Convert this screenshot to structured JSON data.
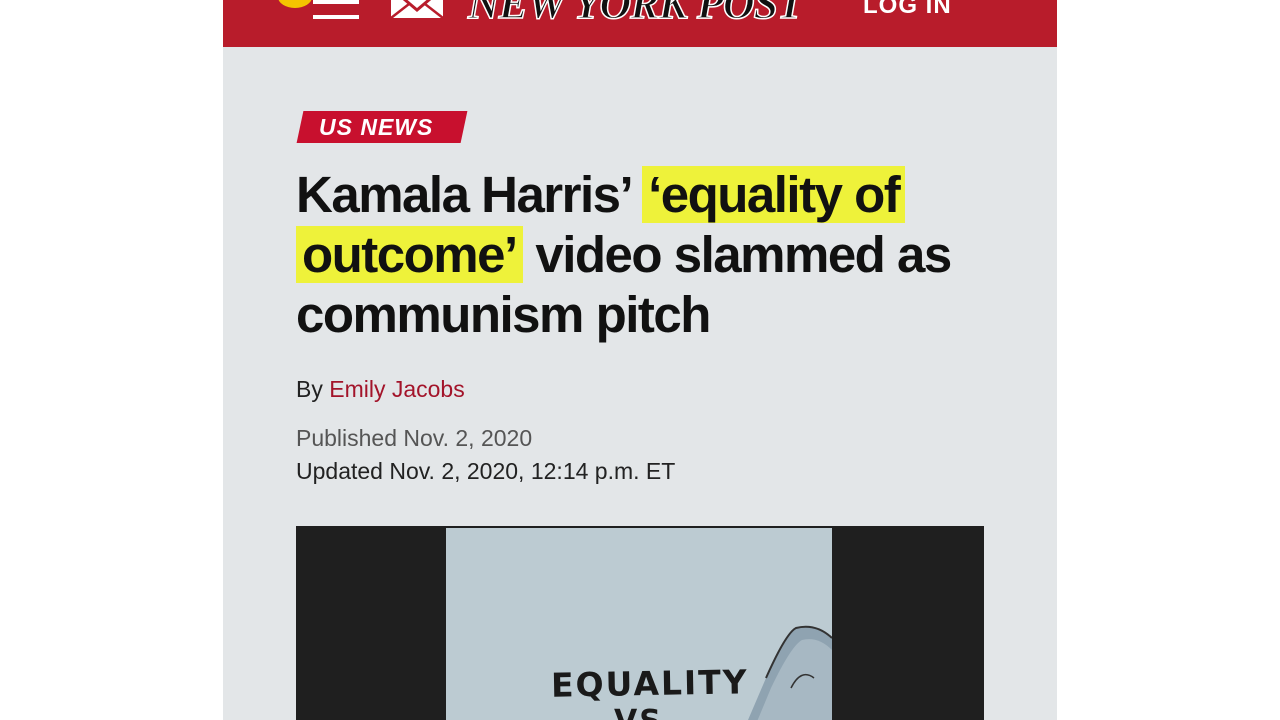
{
  "header": {
    "logo": "NEW YORK POST",
    "login_label": "LOG IN",
    "menu_icon": "hamburger-menu-icon",
    "mail_icon": "envelope-icon",
    "brand_color": "#b81c2b"
  },
  "article": {
    "section": "US NEWS",
    "headline_part1": "Kamala Harris’ ",
    "headline_highlight1": "‘equality of",
    "headline_highlight2": "outcome’",
    "headline_part2": " video slammed as communism pitch",
    "byline_prefix": "By",
    "author": "Emily Jacobs",
    "published": "Published Nov. 2, 2020",
    "updated": "Updated Nov. 2, 2020, 12:14 p.m. ET",
    "highlight_color": "#eef23a"
  },
  "video": {
    "caption_line1": "EQUALITY",
    "caption_line2": "VS"
  }
}
